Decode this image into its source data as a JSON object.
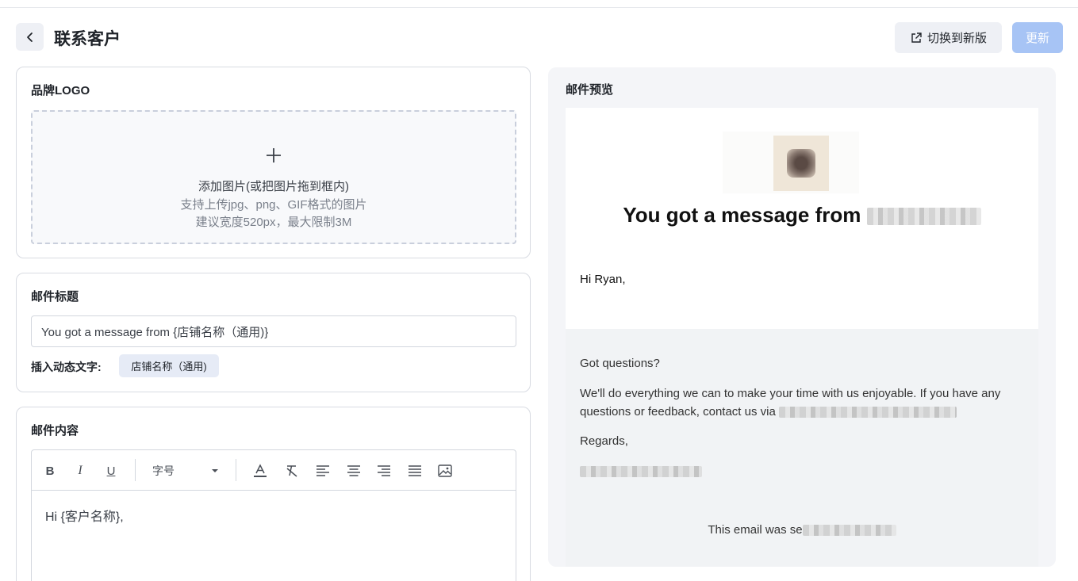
{
  "header": {
    "title": "联系客户",
    "switch_label": "切换到新版",
    "update_label": "更新"
  },
  "logo_card": {
    "title": "品牌LOGO",
    "upload_line1": "添加图片(或把图片拖到框内)",
    "upload_line2": "支持上传jpg、png、GIF格式的图片",
    "upload_line3": "建议宽度520px，最大限制3M"
  },
  "subject_card": {
    "title": "邮件标题",
    "value": "You got a message from {店铺名称（通用)}",
    "insert_label": "插入动态文字:",
    "tag_label": "店铺名称（通用)"
  },
  "content_card": {
    "title": "邮件内容",
    "toolbar": {
      "bold": "B",
      "italic": "I",
      "underline": "U",
      "font_size": "字号",
      "font_color": "A"
    },
    "body": "Hi {客户名称},"
  },
  "preview": {
    "title": "邮件预览",
    "heading": "You got a message from",
    "greeting": "Hi Ryan,",
    "questions": "Got questions?",
    "body": "We'll do everything we can to make your time with us enjoyable. If you have any questions or feedback, contact us via",
    "regards": "Regards,",
    "sent": "This email was se"
  },
  "colors": {
    "primary_disabled": "#a7c4f5",
    "secondary_bg": "#eef0f5",
    "preview_bg": "#f4f5f8"
  }
}
